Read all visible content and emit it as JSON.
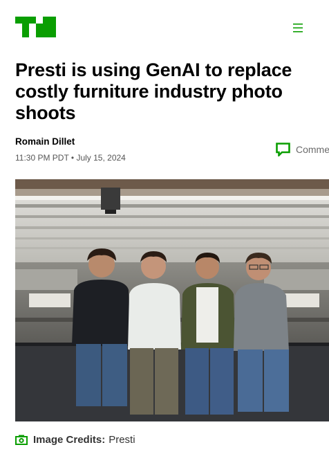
{
  "site": {
    "logo_icon": "techcrunch-logo",
    "menu_icon": "hamburger-menu-icon",
    "brand_color": "#0a9e01"
  },
  "article": {
    "headline": "Presti is using GenAI to replace costly furniture industry photo shoots",
    "author": "Romain Dillet",
    "dateline": "11:30 PM PDT • July 15, 2024",
    "comments_label": "Comments",
    "comments_icon": "comment-bubble-icon"
  },
  "hero_image": {
    "description_icon": "photo",
    "credits_icon": "camera-icon",
    "credits_label": "Image Credits:",
    "credits_value": "Presti"
  }
}
